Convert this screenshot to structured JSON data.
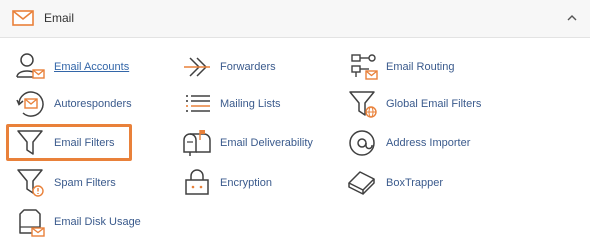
{
  "header": {
    "title": "Email",
    "icon": "envelope-icon",
    "collapse_icon": "chevron-up-icon"
  },
  "colors": {
    "accent": "#e9813a",
    "icon_stroke": "#404040",
    "link": "#3366a8"
  },
  "items": [
    {
      "label": "Email Accounts",
      "icon": "email-accounts-icon",
      "active_link": true
    },
    {
      "label": "Forwarders",
      "icon": "forwarders-icon"
    },
    {
      "label": "Email Routing",
      "icon": "email-routing-icon"
    },
    {
      "label": "Autoresponders",
      "icon": "autoresponders-icon"
    },
    {
      "label": "Mailing Lists",
      "icon": "mailing-lists-icon"
    },
    {
      "label": "Global Email Filters",
      "icon": "global-email-filters-icon"
    },
    {
      "label": "Email Filters",
      "icon": "email-filters-icon",
      "highlighted": true
    },
    {
      "label": "Email Deliverability",
      "icon": "email-deliverability-icon"
    },
    {
      "label": "Address Importer",
      "icon": "address-importer-icon"
    },
    {
      "label": "Spam Filters",
      "icon": "spam-filters-icon"
    },
    {
      "label": "Encryption",
      "icon": "encryption-icon"
    },
    {
      "label": "BoxTrapper",
      "icon": "boxtrapper-icon"
    },
    {
      "label": "Email Disk Usage",
      "icon": "email-disk-usage-icon"
    }
  ]
}
